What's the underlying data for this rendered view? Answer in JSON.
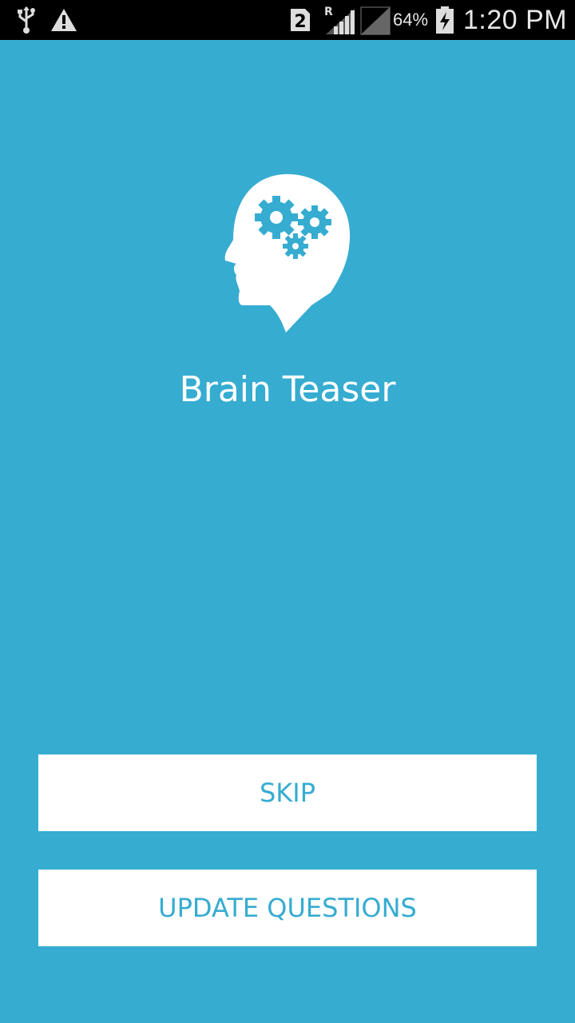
{
  "status_bar": {
    "sim_slot": "2",
    "roaming": "R",
    "battery_percent": "64%",
    "time": "1:20 PM",
    "icons": [
      "usb-icon",
      "alert-icon",
      "sim-icon",
      "signal-icon",
      "signal-icon",
      "battery-charging-icon"
    ]
  },
  "app": {
    "title": "Brain Teaser",
    "logo_icon": "head-gears-icon"
  },
  "actions": {
    "skip_label": "SKIP",
    "update_label": "UPDATE QUESTIONS"
  },
  "colors": {
    "background": "#36acd1",
    "status_bar": "#000000",
    "button_bg": "#ffffff",
    "button_text": "#36acd1"
  }
}
